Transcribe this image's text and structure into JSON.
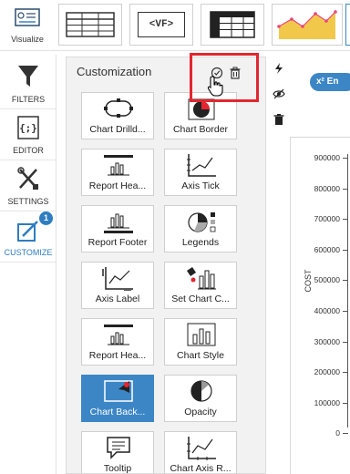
{
  "toolbar": {
    "visualize_label": "Visualize",
    "vf_label": "<VF>"
  },
  "sidebar": {
    "items": [
      {
        "label": "FILTERS",
        "icon": "funnel-icon"
      },
      {
        "label": "EDITOR",
        "icon": "code-braces-icon"
      },
      {
        "label": "SETTINGS",
        "icon": "wrench-screwdriver-icon"
      },
      {
        "label": "CUSTOMIZE",
        "icon": "customize-icon",
        "badge": "1"
      }
    ]
  },
  "panel": {
    "title": "Customization",
    "tiles": [
      {
        "label": "Chart Drilld...",
        "icon": "chart-drilldown-icon"
      },
      {
        "label": "Chart Border",
        "icon": "chart-border-icon"
      },
      {
        "label": "Report Hea...",
        "icon": "report-header-icon"
      },
      {
        "label": "Axis Tick",
        "icon": "axis-tick-icon"
      },
      {
        "label": "Report Footer",
        "icon": "report-footer-icon"
      },
      {
        "label": "Legends",
        "icon": "legends-icon"
      },
      {
        "label": "Axis Label",
        "icon": "axis-label-icon"
      },
      {
        "label": "Set Chart C...",
        "icon": "set-chart-color-icon"
      },
      {
        "label": "Report Hea...",
        "icon": "report-header-icon"
      },
      {
        "label": "Chart Style",
        "icon": "chart-style-icon"
      },
      {
        "label": "Chart Back...",
        "icon": "chart-background-icon",
        "selected": true
      },
      {
        "label": "Opacity",
        "icon": "opacity-icon"
      },
      {
        "label": "Tooltip",
        "icon": "tooltip-icon"
      },
      {
        "label": "Chart Axis R...",
        "icon": "chart-axis-range-icon"
      }
    ]
  },
  "right": {
    "en_button": "x² En"
  },
  "chart": {
    "ylabel": "COST",
    "ticks": [
      "900000",
      "800000",
      "700000",
      "600000",
      "500000",
      "400000",
      "300000",
      "200000",
      "100000",
      "0"
    ]
  },
  "colors": {
    "accent": "#3c86c6",
    "highlight": "#e3262f",
    "chart_yellow": "#f2c84b",
    "chart_pink": "#e8467c"
  }
}
